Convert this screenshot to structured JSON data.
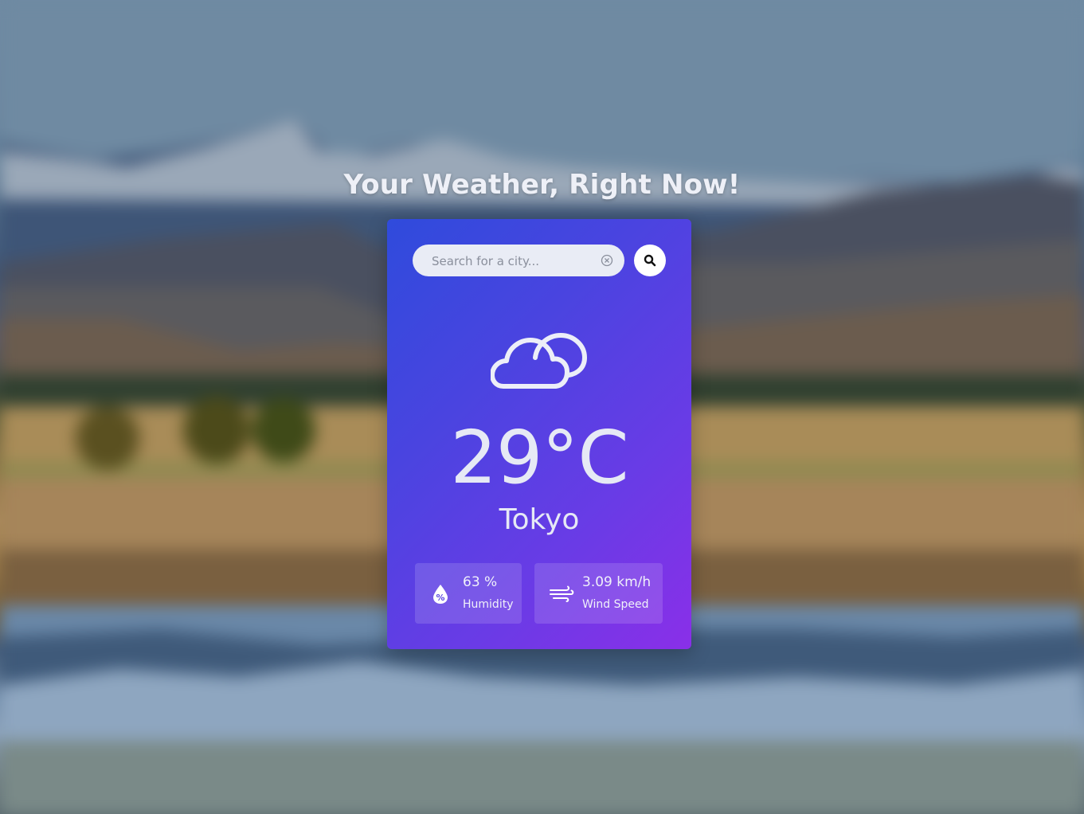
{
  "header": {
    "title": "Your Weather, Right Now!"
  },
  "search": {
    "placeholder": "Search for a city..."
  },
  "weather": {
    "condition_icon": "cloud-icon",
    "temperature": "29°C",
    "city": "Tokyo"
  },
  "stats": {
    "humidity": {
      "icon": "humidity-drop-icon",
      "value": "63 %",
      "label": "Humidity"
    },
    "wind": {
      "icon": "wind-icon",
      "value": "3.09 km/h",
      "label": "Wind Speed"
    }
  },
  "colors": {
    "card_gradient_start": "#2f4bdc",
    "card_gradient_end": "#8a2fe8",
    "text_light": "#e6e9f5"
  }
}
